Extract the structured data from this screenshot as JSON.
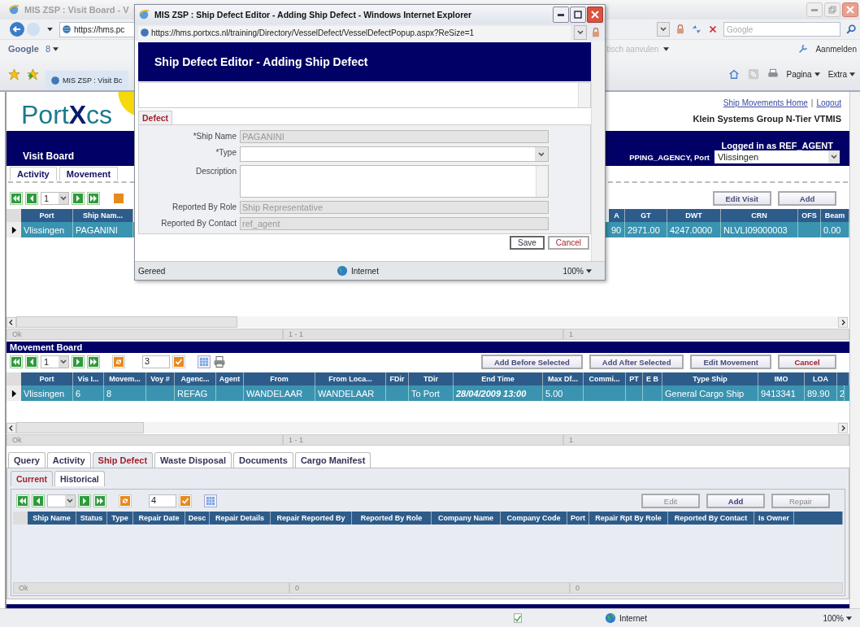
{
  "browser": {
    "title": "MIS ZSP : Visit Board - V",
    "address": "https://hms.pc",
    "search_placeholder": "Google",
    "google_label": "Google",
    "google_menu": "8",
    "autofill": "tisch aanvulen",
    "sign_in": "Aanmelden",
    "tab": "MIS ZSP : Visit Bc",
    "page_menu": "Pagina",
    "extra_menu": "Extra",
    "status_zone": "Internet",
    "status_zoom": "100%"
  },
  "header": {
    "logo": "Port**X**cs",
    "title": "Visit Board",
    "links": [
      "Ship Movements Home",
      "Logout"
    ],
    "link_separator": "|",
    "system": "Klein Systems Group N-Tier VTMIS",
    "logged_in": "Logged in as REF_AGENT",
    "org_port_label": "PPING_AGENCY, Port",
    "port": "Vlissingen"
  },
  "visit_tabs": [
    {
      "label": "Activity",
      "selected": false
    },
    {
      "label": "Movement",
      "selected": false
    }
  ],
  "visit_board": {
    "page": "1",
    "buttons": [
      "Edit Visit",
      "Add"
    ],
    "columns_left": [
      "Port",
      "Ship Nam..."
    ],
    "columns_right": [
      "A",
      "GT",
      "DWT",
      "CRN",
      "OFS",
      "Beam"
    ],
    "rows": [
      {
        "selected": true,
        "left": [
          {
            "kind": "text",
            "text": "Vlissingen"
          },
          {
            "kind": "text",
            "text": "PAGANINI"
          }
        ],
        "right": [
          {
            "kind": "text",
            "text": "90"
          },
          {
            "kind": "text",
            "text": "2971.00"
          },
          {
            "kind": "text",
            "text": "4247.0000"
          },
          {
            "kind": "text",
            "text": "NLVLI09000003"
          },
          {
            "kind": "blank"
          },
          {
            "kind": "text",
            "text": "0.00"
          }
        ]
      }
    ],
    "status": [
      "Ok",
      "1 - 1",
      "1"
    ]
  },
  "movement_board": {
    "title": "Movement Board",
    "page": "1",
    "page_size": "3",
    "buttons": [
      {
        "label": "Add Before Selected",
        "kind": "normal"
      },
      {
        "label": "Add After Selected",
        "kind": "normal"
      },
      {
        "label": "Edit Movement",
        "kind": "normal"
      },
      {
        "label": "Cancel",
        "kind": "cancel"
      }
    ],
    "columns": [
      "Port",
      "Vis I...",
      "Movem...",
      "Voy #",
      "Agenc...",
      "Agent",
      "From",
      "From Loca...",
      "FDir",
      "TDir",
      "End Time",
      "Max Df...",
      "Commi...",
      "PT",
      "E B",
      "Type Ship",
      "IMO",
      "LOA"
    ],
    "rows": [
      {
        "selected": true,
        "cells": [
          {
            "kind": "text",
            "text": "Vlissingen"
          },
          {
            "kind": "text",
            "text": "6"
          },
          {
            "kind": "text",
            "text": "8"
          },
          {
            "kind": "blank"
          },
          {
            "kind": "text",
            "text": "REFAG"
          },
          {
            "kind": "blank"
          },
          {
            "kind": "text",
            "text": "WANDELAAR"
          },
          {
            "kind": "text",
            "text": "WANDELAAR"
          },
          {
            "kind": "blank"
          },
          {
            "kind": "text",
            "text": "To Port"
          },
          {
            "kind": "text",
            "text": "28/04/2009 13:00"
          },
          {
            "kind": "text",
            "text": "5.00"
          },
          {
            "kind": "blank"
          },
          {
            "kind": "blank"
          },
          {
            "kind": "blank"
          },
          {
            "kind": "text",
            "text": "General Cargo Ship"
          },
          {
            "kind": "text",
            "text": "9413341"
          },
          {
            "kind": "text",
            "text": "89.90"
          },
          {
            "kind": "text",
            "text": "2"
          }
        ]
      }
    ],
    "status": [
      "Ok",
      "1 - 1",
      "1"
    ]
  },
  "tabs": [
    {
      "label": "Query",
      "selected": false
    },
    {
      "label": "Activity",
      "selected": false
    },
    {
      "label": "Ship Defect",
      "selected": true
    },
    {
      "label": "Waste Disposal",
      "selected": false
    },
    {
      "label": "Documents",
      "selected": false
    },
    {
      "label": "Cargo Manifest",
      "selected": false
    }
  ],
  "sub_tabs": [
    {
      "label": "Current",
      "selected": true
    },
    {
      "label": "Historical",
      "selected": false
    }
  ],
  "defect_board": {
    "page_size": "4",
    "buttons": [
      {
        "label": "Edit",
        "disabled": true
      },
      {
        "label": "Add",
        "disabled": false
      },
      {
        "label": "Repair",
        "disabled": true
      }
    ],
    "columns": [
      "Ship Name",
      "Status",
      "Type",
      "Repair Date",
      "Desc",
      "Repair Details",
      "Repair Reported By",
      "Reported By Role",
      "Company Name",
      "Company Code",
      "Port",
      "Repair Rpt By Role",
      "Reported By Contact",
      "Is Owner"
    ],
    "status": [
      "Ok",
      "0",
      "0"
    ]
  },
  "popup": {
    "title": "MIS ZSP : Ship Defect Editor - Adding Ship Defect - Windows Internet Explorer",
    "address": "https://hms.portxcs.nl/training/Directory/VesselDefect/VesselDefectPopup.aspx?ReSize=1",
    "heading": "Ship Defect Editor - Adding Ship Defect",
    "tab": "Defect",
    "fields": [
      {
        "label": "*Ship Name",
        "kind": "text",
        "value": "PAGANINI",
        "disabled": true
      },
      {
        "label": "*Type",
        "kind": "select",
        "disabled": false
      },
      {
        "label": "Description",
        "kind": "textarea",
        "disabled": false
      },
      {
        "label": "Reported By Role",
        "kind": "text",
        "value": "Ship Representative",
        "disabled": true
      },
      {
        "label": "Reported By Contact",
        "kind": "text",
        "value": "ref_agent",
        "disabled": true
      }
    ],
    "buttons": [
      {
        "label": "Save",
        "kind": "save"
      },
      {
        "label": "Cancel",
        "kind": "cancel"
      }
    ],
    "status": "Gereed",
    "zone": "Internet",
    "zoom": "100%"
  }
}
